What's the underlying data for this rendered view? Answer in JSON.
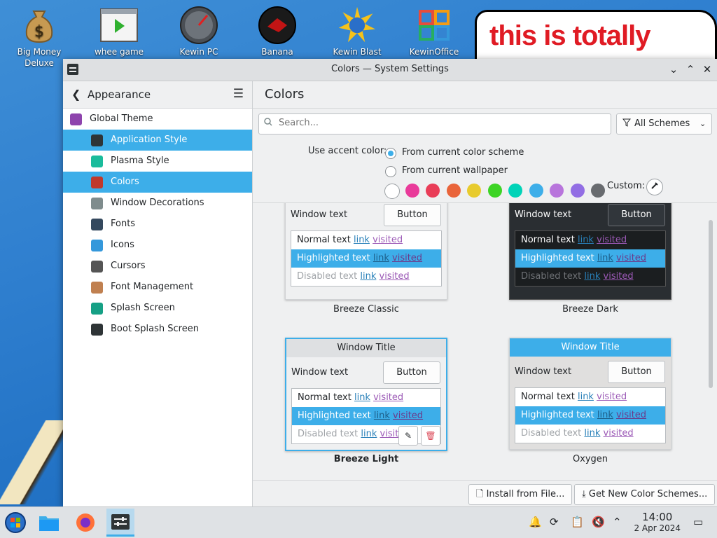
{
  "desktop": {
    "icons": [
      {
        "label": "Big Money Deluxe",
        "icon": "money-bag-icon"
      },
      {
        "label": "whee game",
        "icon": "video-player-icon"
      },
      {
        "label": "Kewin PC",
        "icon": "gauge-icon"
      },
      {
        "label": "Banana Please",
        "icon": "red-disc-icon"
      },
      {
        "label": "Kewin Blast",
        "icon": "starburst-globe-icon"
      },
      {
        "label": "KewinOffice",
        "icon": "office-squares-icon"
      }
    ],
    "banner_text": "this is totally"
  },
  "window": {
    "title": "Colors — System Settings",
    "buttons": {
      "minimize": "⌄",
      "maximize": "⌃",
      "close": "✕"
    }
  },
  "sidebar": {
    "title": "Appearance",
    "items": [
      {
        "label": "Global Theme",
        "icon": "global-theme-icon",
        "level": "top",
        "selected": false
      },
      {
        "label": "Application Style",
        "icon": "brush-icon",
        "level": "sub",
        "selected": true
      },
      {
        "label": "Plasma Style",
        "icon": "plasma-icon",
        "level": "sub",
        "selected": false
      },
      {
        "label": "Colors",
        "icon": "color-wheel-icon",
        "level": "sub",
        "selected": true
      },
      {
        "label": "Window Decorations",
        "icon": "window-icon",
        "level": "sub",
        "selected": false
      },
      {
        "label": "Fonts",
        "icon": "fonts-icon",
        "level": "sub",
        "selected": false
      },
      {
        "label": "Icons",
        "icon": "icons-grid-icon",
        "level": "sub",
        "selected": false
      },
      {
        "label": "Cursors",
        "icon": "cursor-icon",
        "level": "sub",
        "selected": false
      },
      {
        "label": "Font Management",
        "icon": "font-management-icon",
        "level": "sub",
        "selected": false
      },
      {
        "label": "Splash Screen",
        "icon": "splash-icon",
        "level": "sub",
        "selected": false
      },
      {
        "label": "Boot Splash Screen",
        "icon": "monitor-icon",
        "level": "sub",
        "selected": false
      }
    ]
  },
  "content": {
    "title": "Colors",
    "search_placeholder": "Search...",
    "filter_label": "All Schemes",
    "accent_label": "Use accent color:",
    "accent_options": [
      {
        "label": "From current color scheme",
        "checked": true
      },
      {
        "label": "From current wallpaper",
        "checked": false
      }
    ],
    "swatches": [
      "#ffffff",
      "#e93a9a",
      "#e93d58",
      "#e9643a",
      "#e8cb2d",
      "#3dd425",
      "#00d3b8",
      "#3daee9",
      "#b875dc",
      "#926ee4",
      "#686b6f"
    ],
    "custom_label": "Custom:",
    "schemes": [
      {
        "name": "Breeze Classic",
        "bold": false,
        "theme": "light",
        "title": "",
        "window_text": "Window text",
        "button": "Button",
        "normal": "Normal text",
        "highlighted": "Highlighted text",
        "disabled": "Disabled text",
        "link": "link",
        "visited": "visited"
      },
      {
        "name": "Breeze Dark",
        "bold": false,
        "theme": "dark",
        "title": "",
        "window_text": "Window text",
        "button": "Button",
        "normal": "Normal text",
        "highlighted": "Highlighted text",
        "disabled": "Disabled text",
        "link": "link",
        "visited": "visited"
      },
      {
        "name": "Breeze Light",
        "bold": true,
        "theme": "light",
        "title": "Window Title",
        "window_text": "Window text",
        "button": "Button",
        "normal": "Normal text",
        "highlighted": "Highlighted text",
        "disabled": "Disabled text",
        "link": "link",
        "visited": "visited"
      },
      {
        "name": "Oxygen",
        "bold": false,
        "theme": "oxygen",
        "title": "Window Title",
        "window_text": "Window text",
        "button": "Button",
        "normal": "Normal text",
        "highlighted": "Highlighted text",
        "disabled": "Disabled text",
        "link": "link",
        "visited": "visited"
      }
    ],
    "footer": {
      "install_label": "Install from File...",
      "get_new_label": "Get New Color Schemes..."
    }
  },
  "taskbar": {
    "time": "14:00",
    "date": "2 Apr 2024"
  }
}
